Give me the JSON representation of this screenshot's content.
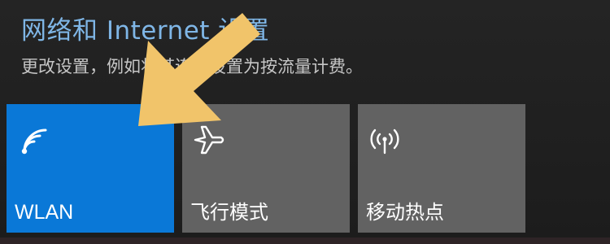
{
  "header": {
    "link_text": "网络和 Internet 设置",
    "description": "更改设置，例如将某连接设置为按流量计费。"
  },
  "quick_actions": [
    {
      "label": "WLAN",
      "icon": "wifi-icon",
      "active": true,
      "color": "#0a78d7"
    },
    {
      "label": "飞行模式",
      "icon": "airplane-icon",
      "active": false,
      "color": "#626262"
    },
    {
      "label": "移动热点",
      "icon": "hotspot-icon",
      "active": false,
      "color": "#626262"
    }
  ],
  "colors": {
    "accent": "#0a78d7",
    "link": "#7fb6e6",
    "annotation_arrow": "#f1c46a"
  }
}
